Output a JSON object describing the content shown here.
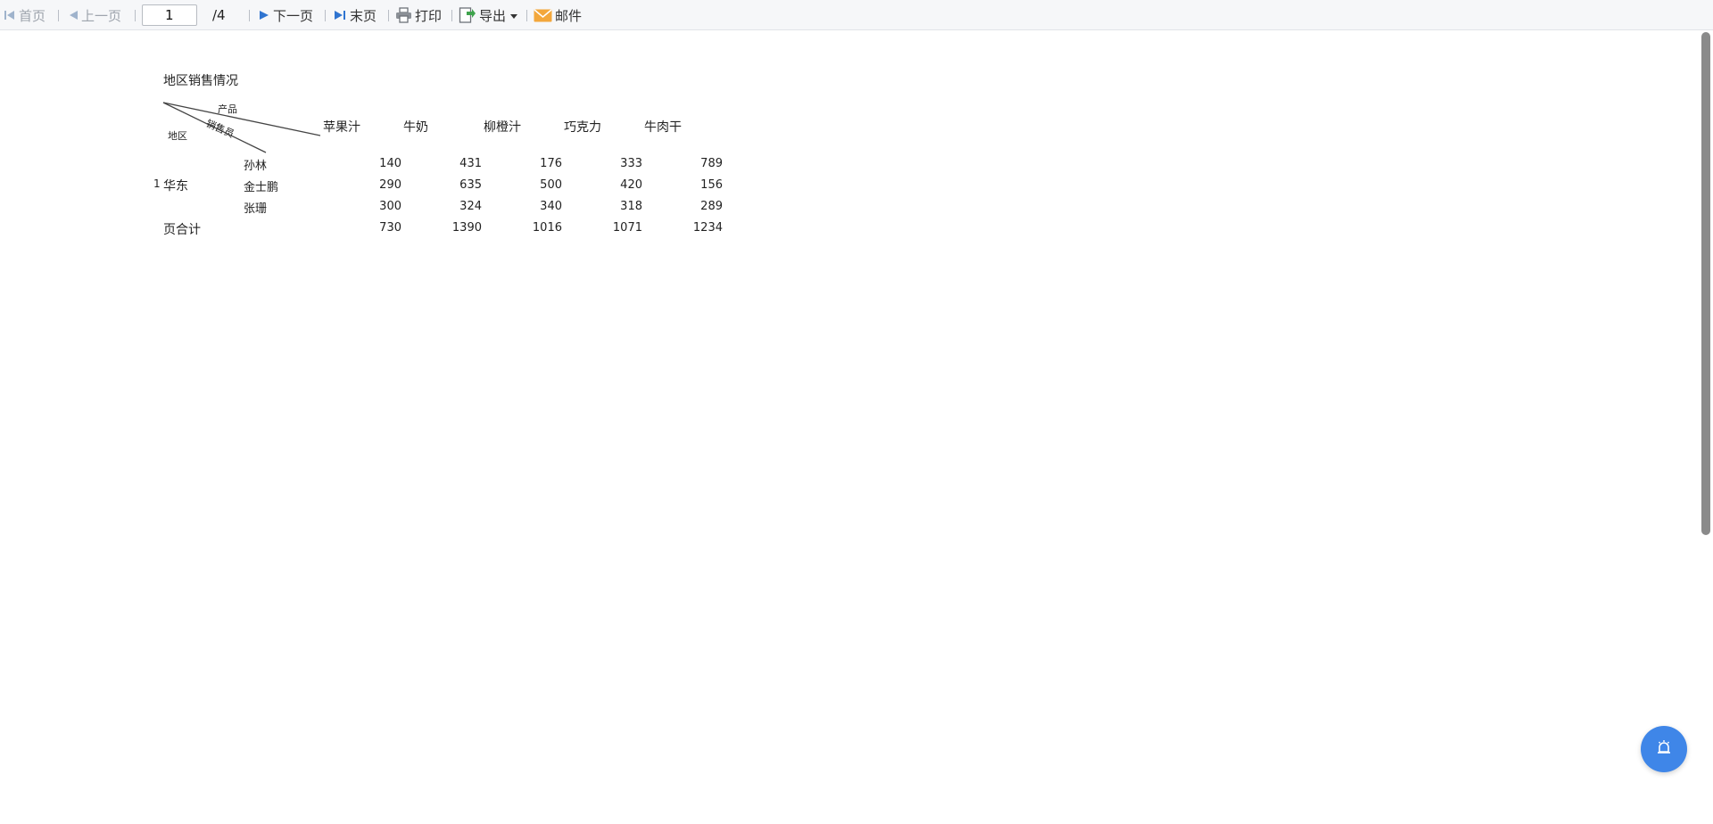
{
  "toolbar": {
    "first_label": "首页",
    "prev_label": "上一页",
    "page_value": "1",
    "total_label": "/4",
    "next_label": "下一页",
    "last_label": "末页",
    "print_label": "打印",
    "export_label": "导出",
    "mail_label": "邮件"
  },
  "report": {
    "title": "地区销售情况",
    "diag": {
      "product": "产品",
      "salesperson": "销售员",
      "region": "地区"
    },
    "products": [
      "苹果汁",
      "牛奶",
      "柳橙汁",
      "巧克力",
      "牛肉干"
    ],
    "region_index": "1",
    "region": "华东",
    "rows": [
      {
        "name": "孙林",
        "values": [
          "140",
          "431",
          "176",
          "333",
          "789"
        ]
      },
      {
        "name": "金士鹏",
        "values": [
          "290",
          "635",
          "500",
          "420",
          "156"
        ]
      },
      {
        "name": "张珊",
        "values": [
          "300",
          "324",
          "340",
          "318",
          "289"
        ]
      }
    ],
    "total": {
      "label": "页合计",
      "values": [
        "730",
        "1390",
        "1016",
        "1071",
        "1234"
      ]
    }
  },
  "colors": {
    "accent": "#3f86e8",
    "disabled_text": "#9ea4ad",
    "toolbar_bg": "#f6f7f9"
  },
  "icons": [
    "first-page-icon",
    "prev-page-icon",
    "next-page-icon",
    "last-page-icon",
    "print-icon",
    "export-icon",
    "dropdown-caret-icon",
    "mail-icon",
    "alarm-icon"
  ]
}
